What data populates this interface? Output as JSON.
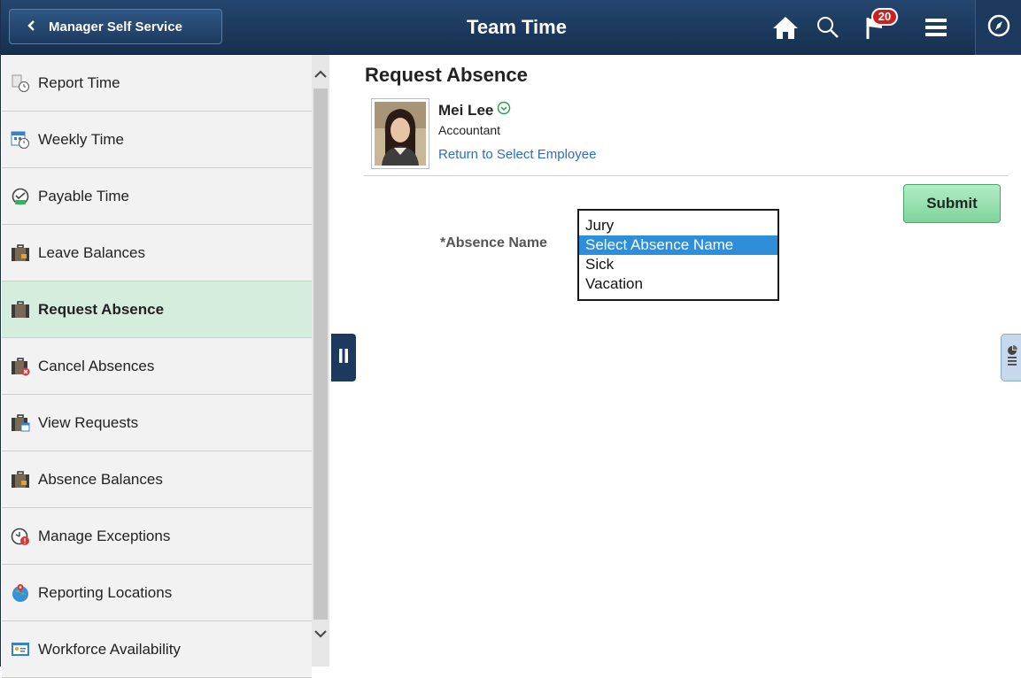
{
  "header": {
    "back_label": "Manager Self Service",
    "title": "Team Time",
    "notification_count": "20",
    "icons": [
      "home-icon",
      "search-icon",
      "flag-icon",
      "menu-icon",
      "compass-icon"
    ]
  },
  "sidebar": {
    "items": [
      {
        "label": "Report Time",
        "icon": "clock-report-icon"
      },
      {
        "label": "Weekly Time",
        "icon": "calendar-clock-icon"
      },
      {
        "label": "Payable Time",
        "icon": "stopwatch-icon"
      },
      {
        "label": "Leave Balances",
        "icon": "briefcase-icon"
      },
      {
        "label": "Request Absence",
        "icon": "briefcase-icon",
        "selected": true
      },
      {
        "label": "Cancel Absences",
        "icon": "briefcase-cancel-icon"
      },
      {
        "label": "View Requests",
        "icon": "briefcase-calendar-icon"
      },
      {
        "label": "Absence Balances",
        "icon": "briefcase-icon"
      },
      {
        "label": "Manage Exceptions",
        "icon": "clock-alert-icon"
      },
      {
        "label": "Reporting Locations",
        "icon": "globe-pin-icon"
      },
      {
        "label": "Workforce Availability",
        "icon": "presentation-icon"
      }
    ]
  },
  "main": {
    "title": "Request Absence",
    "employee": {
      "name": "Mei Lee",
      "job_title": "Accountant",
      "return_link": "Return to Select Employee"
    },
    "submit_label": "Submit",
    "absence_field": {
      "label": "*Absence Name",
      "options": [
        "Jury",
        "Select Absence Name",
        "Sick",
        "Vacation"
      ],
      "selected": "Select Absence Name"
    }
  },
  "colors": {
    "header": "#1d3a5e",
    "selected_nav": "#d5eddd",
    "submit": "#8ddca8",
    "link": "#2f6cc5",
    "highlight": "#2e8ed9"
  }
}
